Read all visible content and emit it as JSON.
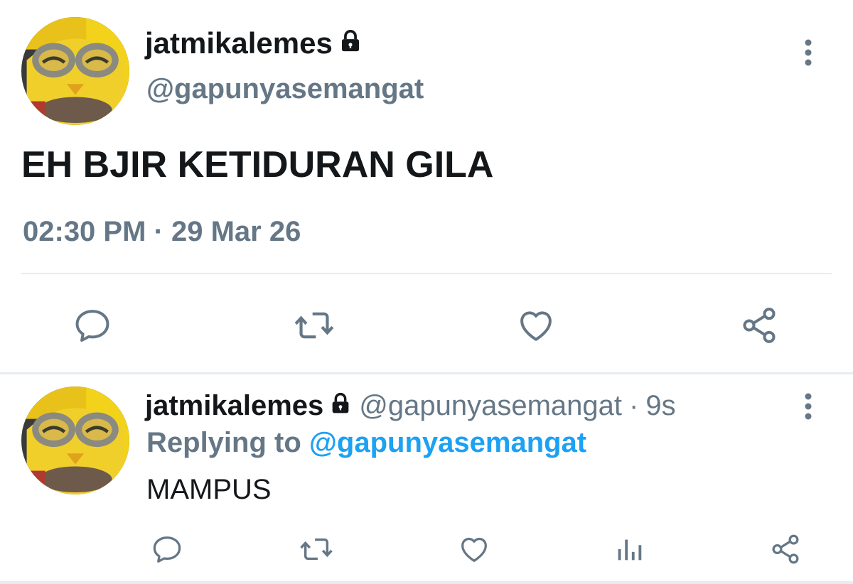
{
  "main_tweet": {
    "display_name": "jatmikalemes",
    "handle": "@gapunyasemangat",
    "text": "EH BJIR KETIDURAN GILA",
    "timestamp": "02:30 PM · 29 Mar 26",
    "protected_icon": "lock-icon",
    "actions": [
      "reply-icon",
      "retweet-icon",
      "like-icon",
      "share-icon"
    ]
  },
  "reply_tweet": {
    "display_name": "jatmikalemes",
    "handle": "@gapunyasemangat",
    "separator": "·",
    "age": "9s",
    "replying_prefix": "Replying to",
    "replying_to": "@gapunyasemangat",
    "text": "MAMPUS",
    "protected_icon": "lock-icon",
    "actions": [
      "reply-icon",
      "retweet-icon",
      "like-icon",
      "analytics-icon",
      "share-icon"
    ]
  },
  "colors": {
    "primary_text": "#14171a",
    "secondary_text": "#657786",
    "link": "#1da1f2",
    "divider": "#e6ecf0",
    "icon": "#657786"
  }
}
